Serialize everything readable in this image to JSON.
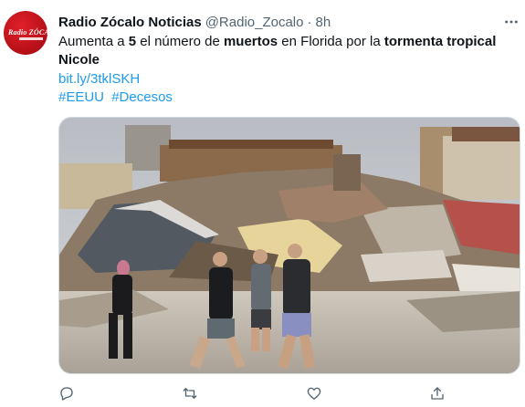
{
  "tweet": {
    "author_name": "Radio Zócalo Noticias",
    "author_handle": "@Radio_Zocalo",
    "separator": "·",
    "time": "8h",
    "avatar_logo_text": "Radio ZÓCALO",
    "text_segments": [
      {
        "text": "Aumenta a ",
        "bold": false
      },
      {
        "text": "5",
        "bold": true
      },
      {
        "text": " el número de ",
        "bold": false
      },
      {
        "text": "muertos",
        "bold": true
      },
      {
        "text": " en Florida por la ",
        "bold": false
      },
      {
        "text": "tormenta tropical Nicole",
        "bold": true
      }
    ],
    "link": "bit.ly/3tklSKH",
    "hashtags": [
      "#EEUU",
      "#Decesos"
    ],
    "media_icon": "photo-collapsed-building-debris"
  },
  "actions": [
    {
      "name": "reply",
      "icon": "speech-bubble-icon"
    },
    {
      "name": "retweet",
      "icon": "retweet-icon"
    },
    {
      "name": "like",
      "icon": "heart-icon"
    },
    {
      "name": "share",
      "icon": "share-upload-icon"
    }
  ],
  "colors": {
    "text": "#0f1419",
    "secondary": "#536471",
    "link": "#1d9bf0",
    "avatar_red": "#d3121b",
    "border": "#cfd9de"
  }
}
